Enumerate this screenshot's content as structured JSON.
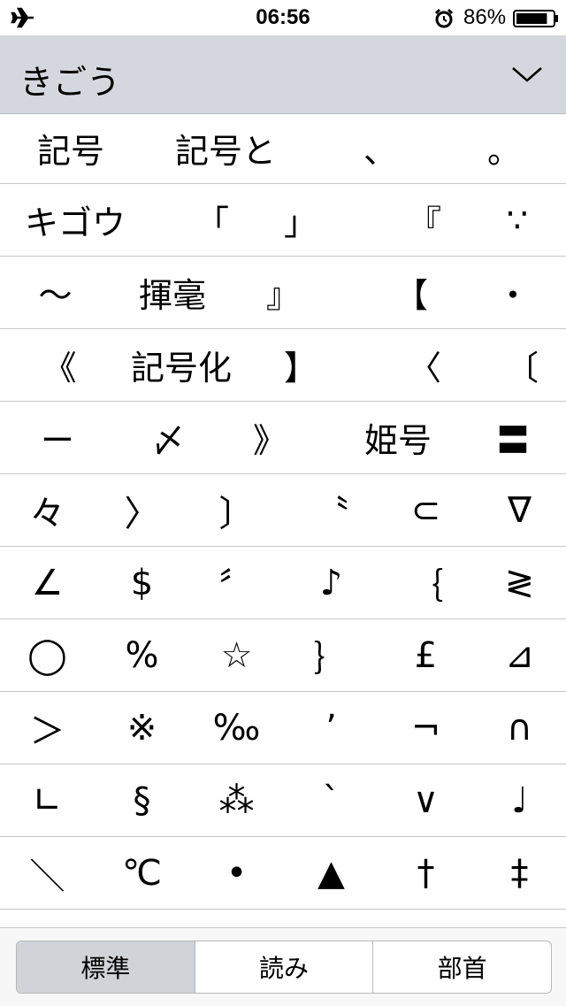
{
  "status_bar": {
    "time": "06:56",
    "battery_percent": "86%",
    "battery_level": 0.86
  },
  "header": {
    "title": "きごう"
  },
  "candidate_rows": [
    [
      "記号",
      "記号と",
      "、",
      "。"
    ],
    [
      "キゴウ",
      "「",
      "」",
      "『",
      "∵"
    ],
    [
      "〜",
      "揮毫",
      "』",
      "【",
      "・"
    ],
    [
      "《",
      "記号化",
      "】",
      "〈",
      "〔"
    ],
    [
      "ー",
      "〆",
      "》",
      "姫号",
      "〓"
    ],
    [
      "々",
      "〉",
      "〕",
      "〝",
      "⊂",
      "∇"
    ],
    [
      "∠",
      "$",
      "〞",
      "♪",
      "｛",
      "≷"
    ],
    [
      "◯",
      "%",
      "☆",
      "｝",
      "£",
      "⊿"
    ],
    [
      "＞",
      "※",
      "‰",
      "’",
      "¬",
      "∩"
    ],
    [
      "∟",
      "§",
      "⁂",
      "`",
      "∨",
      "♩"
    ],
    [
      "＼",
      "℃",
      "•",
      "▲",
      "†",
      "‡"
    ]
  ],
  "segmented_control": {
    "options": [
      "標準",
      "読み",
      "部首"
    ],
    "selected": "標準"
  }
}
